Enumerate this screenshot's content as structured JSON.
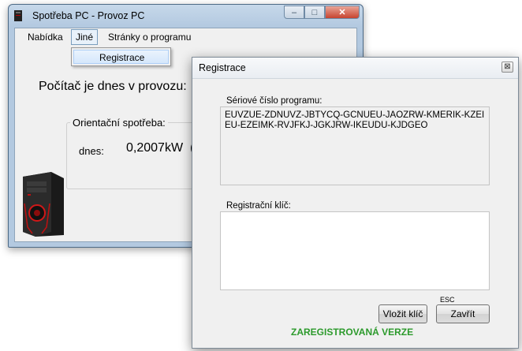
{
  "main_window": {
    "title": "Spotřeba PC - Provoz PC",
    "menu": {
      "items": [
        "Nabídka",
        "Jiné",
        "Stránky o programu"
      ],
      "dropdown_item": "Registrace"
    },
    "uptime_label": "Počítač je dnes v provozu:",
    "consumption": {
      "group_title": "Orientační spotřeba:",
      "today_label": "dnes:",
      "today_value": "0,2007kW",
      "trailing": "("
    }
  },
  "dialog": {
    "title": "Registrace",
    "close_glyph": "⊠",
    "serial_label": "Sériové číslo programu:",
    "serial_value": "EUVZUE-ZDNUVZ-JBTYCQ-GCNUEU-JAOZRW-KMERIK-KZEIEU-EZEIMK-RVJFKJ-JGKJRW-IKEUDU-KJDGEO",
    "regkey_label": "Registrační klíč:",
    "regkey_value": "",
    "esc_label": "ESC",
    "paste_button": "Vložit klíč",
    "close_button": "Zavřít",
    "status": "ZAREGISTROVANÁ VERZE"
  },
  "colors": {
    "status_green": "#2c9a2c",
    "close_red": "#c7432f"
  }
}
